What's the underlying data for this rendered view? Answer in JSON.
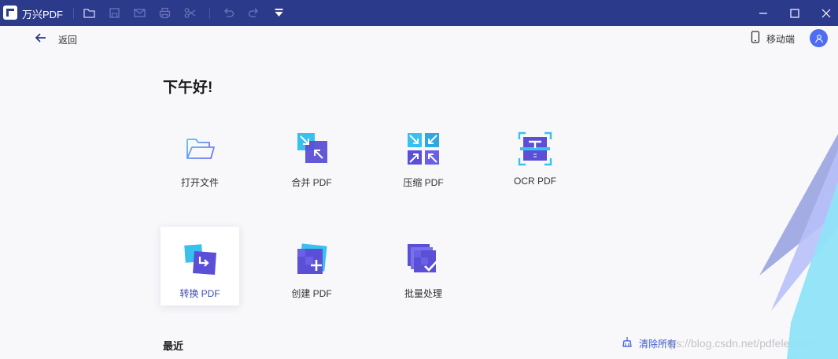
{
  "titlebar": {
    "app_name": "万兴PDF",
    "background": "#2c3a8c",
    "toolbar_icons": [
      "folder-icon",
      "save-icon",
      "mail-icon",
      "print-icon",
      "scissors-icon",
      "undo-icon",
      "redo-icon",
      "dropdown-icon"
    ],
    "window_controls": [
      "minimize-icon",
      "maximize-icon",
      "close-icon"
    ]
  },
  "nav": {
    "back_label": "返回",
    "mobile_label": "移动端"
  },
  "greeting": "下午好!",
  "tiles": [
    {
      "label": "打开文件",
      "icon": "open-folder-icon"
    },
    {
      "label": "合并 PDF",
      "icon": "merge-icon"
    },
    {
      "label": "压缩 PDF",
      "icon": "compress-icon"
    },
    {
      "label": "OCR PDF",
      "icon": "ocr-icon"
    },
    {
      "label": "转换 PDF",
      "icon": "convert-icon",
      "selected": true
    },
    {
      "label": "创建 PDF",
      "icon": "create-icon"
    },
    {
      "label": "批量处理",
      "icon": "batch-icon"
    }
  ],
  "recent": {
    "title": "最近",
    "clear_label": "清除所有"
  },
  "watermark": "https://blog.csdn.net/pdfelement",
  "colors": {
    "accent": "#3a59d6",
    "avatar": "#4e6df0",
    "page_bg": "#f8f8fb"
  }
}
